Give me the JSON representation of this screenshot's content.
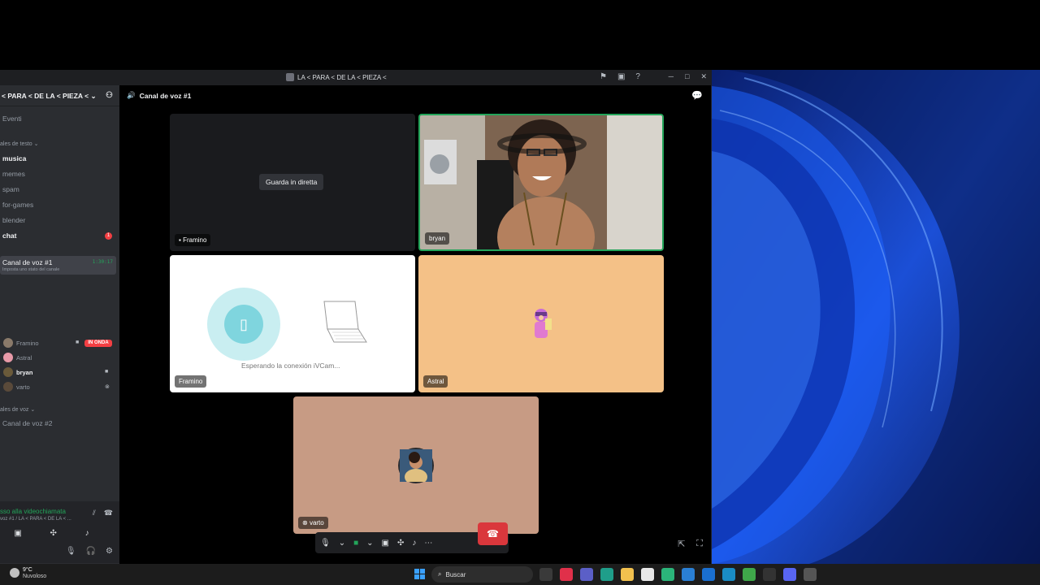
{
  "window": {
    "title": "LA < PARA < DE LA < PIEZA <"
  },
  "sidebar": {
    "server_name": "< PARA < DE LA < PIEZA <",
    "events_label": "Eventi",
    "text_category": "ales de testo",
    "text_channels": [
      "musica",
      "memes",
      "spam",
      "for-games",
      "blender",
      "chat"
    ],
    "chat_badge": "1",
    "voice_channel": {
      "name": "Canal de voz #1",
      "timer": "1:30:17",
      "status": "Imposta uno stato del canale"
    },
    "members": [
      {
        "name": "Framino",
        "live": "IN ONDA"
      },
      {
        "name": "Astral"
      },
      {
        "name": "bryan"
      },
      {
        "name": "varto"
      }
    ],
    "voice_category": "ales de voz",
    "voice_channel_2": "Canal de voz #2"
  },
  "voice_panel": {
    "connected": "sso alla videochiamata",
    "channel_path": "voz #1 / LA < PARA < DE LA < ..."
  },
  "main": {
    "channel_name": "Canal de voz #1",
    "watch_button": "Guarda in diretta",
    "tiles": {
      "stream_label": "Framino",
      "bryan_label": "bryan",
      "framino_label": "Framino",
      "astral_label": "Astral",
      "varto_label": "varto"
    },
    "waiting_text": "Esperando la conexión iVCam..."
  },
  "taskbar": {
    "temperature": "9°C",
    "condition": "Nuvoloso",
    "search_placeholder": "Buscar"
  },
  "colors": {
    "accent_green": "#23a55a",
    "live_red": "#f23f43",
    "end_call_red": "#da373c"
  }
}
